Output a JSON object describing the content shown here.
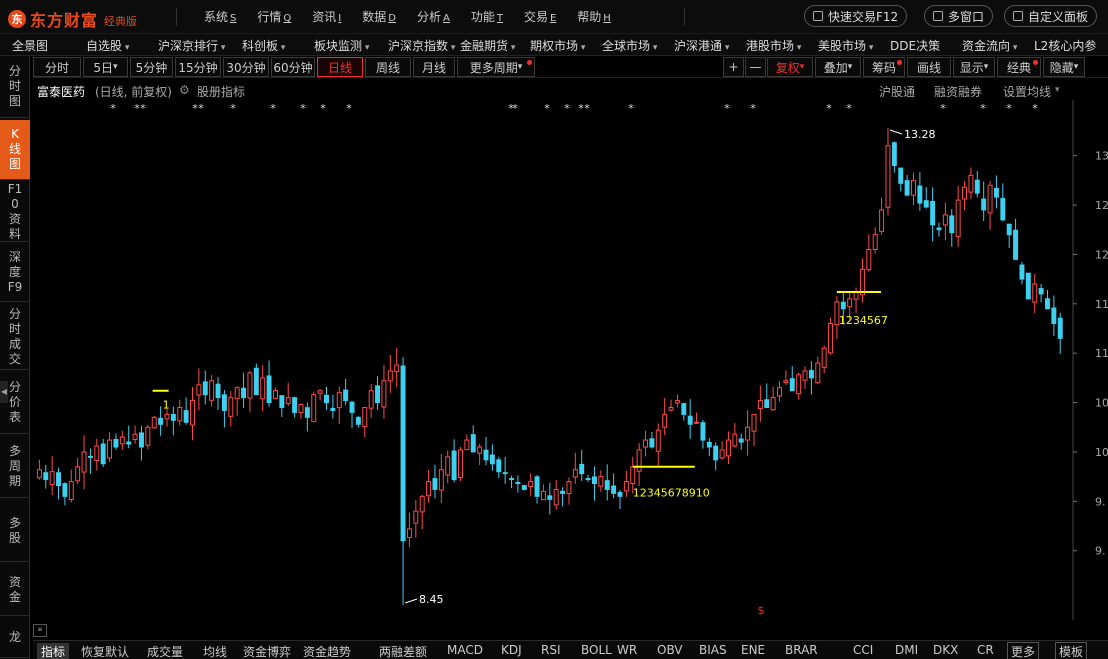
{
  "app": {
    "logo_mark": "东",
    "name": "东方财富",
    "edition": "经典版"
  },
  "main_menu": [
    {
      "label": "系统",
      "key": "S"
    },
    {
      "label": "行情",
      "key": "Q"
    },
    {
      "label": "资讯",
      "key": "I"
    },
    {
      "label": "数据",
      "key": "D"
    },
    {
      "label": "分析",
      "key": "A"
    },
    {
      "label": "功能",
      "key": "T"
    },
    {
      "label": "交易",
      "key": "E"
    },
    {
      "label": "帮助",
      "key": "H"
    }
  ],
  "top_buttons": {
    "quick_trade": "快速交易F12",
    "multi_window": "多窗口",
    "custom_panel": "自定义面板"
  },
  "category_bar": [
    "全景图",
    "自选股",
    "沪深京排行",
    "科创板",
    "板块监测",
    "沪深京指数",
    "金融期货",
    "期权市场",
    "全球市场",
    "沪深港通",
    "港股市场",
    "美股市场",
    "DDE决策",
    "资金流向",
    "L2核心内参"
  ],
  "left_tabs": [
    "分时图",
    "K线图",
    "F10资料",
    "深度F9",
    "分时成交",
    "分价表",
    "多周期",
    "多股",
    "资金",
    "龙"
  ],
  "period_bar": {
    "periods": [
      "分时",
      "5日",
      "5分钟",
      "15分钟",
      "30分钟",
      "60分钟",
      "日线",
      "周线",
      "月线",
      "更多周期"
    ],
    "active": "日线",
    "tools": [
      "+",
      "—",
      "复权",
      "叠加",
      "筹码",
      "画线",
      "显示",
      "经典",
      "隐藏"
    ]
  },
  "info": {
    "stock_name": "富泰医药",
    "period_desc": "(日线, 前复权)",
    "equity_indicator": "股册指标",
    "right_links": [
      "沪股通",
      "融资融券",
      "设置均线"
    ]
  },
  "annotations": {
    "high_label": "13.28",
    "low_label": "8.45",
    "count_label_1": "1",
    "count_label_2": "1234567",
    "count_label_3": "12345678910",
    "dollar": "$"
  },
  "y_axis_ticks": [
    "13.",
    "12.",
    "12.",
    "11.",
    "11.",
    "10.",
    "10.",
    "9.",
    "9."
  ],
  "indicator_bar": [
    "指标",
    "恢复默认",
    "成交量",
    "均线",
    "资金博弈",
    "资金趋势",
    "两融差额",
    "MACD",
    "KDJ",
    "RSI",
    "BOLL",
    "WR",
    "OBV",
    "BIAS",
    "ENE",
    "BRAR",
    "CCI",
    "DMI",
    "DKX",
    "CR",
    "更多",
    "模板"
  ],
  "colors": {
    "up": "#ff4a4a",
    "down": "#3dd0f0",
    "accent": "#e35a19",
    "marker": "#ffff00"
  },
  "chart_data": {
    "type": "candlestick",
    "ylim": [
      8.45,
      13.28
    ],
    "y_ticks": [
      13.0,
      12.5,
      12.0,
      11.5,
      11.0,
      10.5,
      10.0,
      9.5,
      9.0
    ],
    "high": 13.28,
    "low": 8.45,
    "close_series": [
      9.82,
      9.72,
      9.8,
      9.66,
      9.55,
      9.7,
      9.85,
      10.0,
      9.95,
      10.06,
      9.88,
      10.12,
      10.05,
      10.15,
      10.08,
      10.18,
      10.05,
      10.25,
      10.35,
      10.28,
      10.38,
      10.32,
      10.45,
      10.3,
      10.52,
      10.68,
      10.58,
      10.72,
      10.55,
      10.42,
      10.55,
      10.65,
      10.55,
      10.8,
      10.58,
      10.75,
      10.5,
      10.62,
      10.45,
      10.55,
      10.4,
      10.48,
      10.35,
      10.58,
      10.62,
      10.5,
      10.42,
      10.6,
      10.52,
      10.4,
      10.28,
      10.45,
      10.62,
      10.5,
      10.72,
      10.82,
      10.88,
      9.1,
      9.22,
      9.4,
      9.55,
      9.7,
      9.62,
      9.82,
      9.95,
      9.72,
      10.02,
      10.12,
      10.0,
      10.05,
      9.92,
      9.88,
      9.8,
      9.78,
      9.72,
      9.68,
      9.62,
      9.7,
      9.55,
      9.6,
      9.52,
      9.62,
      9.58,
      9.7,
      9.82,
      9.78,
      9.72,
      9.68,
      9.75,
      9.62,
      9.58,
      9.55,
      9.7,
      9.85,
      10.02,
      10.12,
      10.05,
      10.22,
      10.38,
      10.45,
      10.52,
      10.38,
      10.28,
      10.3,
      10.12,
      10.05,
      9.92,
      10.02,
      10.12,
      10.18,
      10.1,
      10.25,
      10.38,
      10.52,
      10.45,
      10.55,
      10.65,
      10.72,
      10.62,
      10.78,
      10.82,
      10.75,
      10.9,
      11.05,
      11.3,
      11.52,
      11.45,
      11.55,
      11.62,
      11.85,
      12.05,
      12.2,
      12.45,
      13.1,
      12.9,
      12.72,
      12.6,
      12.75,
      12.52,
      12.48,
      12.3,
      12.25,
      12.4,
      12.22,
      12.55,
      12.68,
      12.8,
      12.62,
      12.45,
      12.7,
      12.58,
      12.35,
      12.2,
      11.95,
      11.75,
      11.55,
      11.7,
      11.6,
      11.45,
      11.3,
      11.15
    ]
  }
}
